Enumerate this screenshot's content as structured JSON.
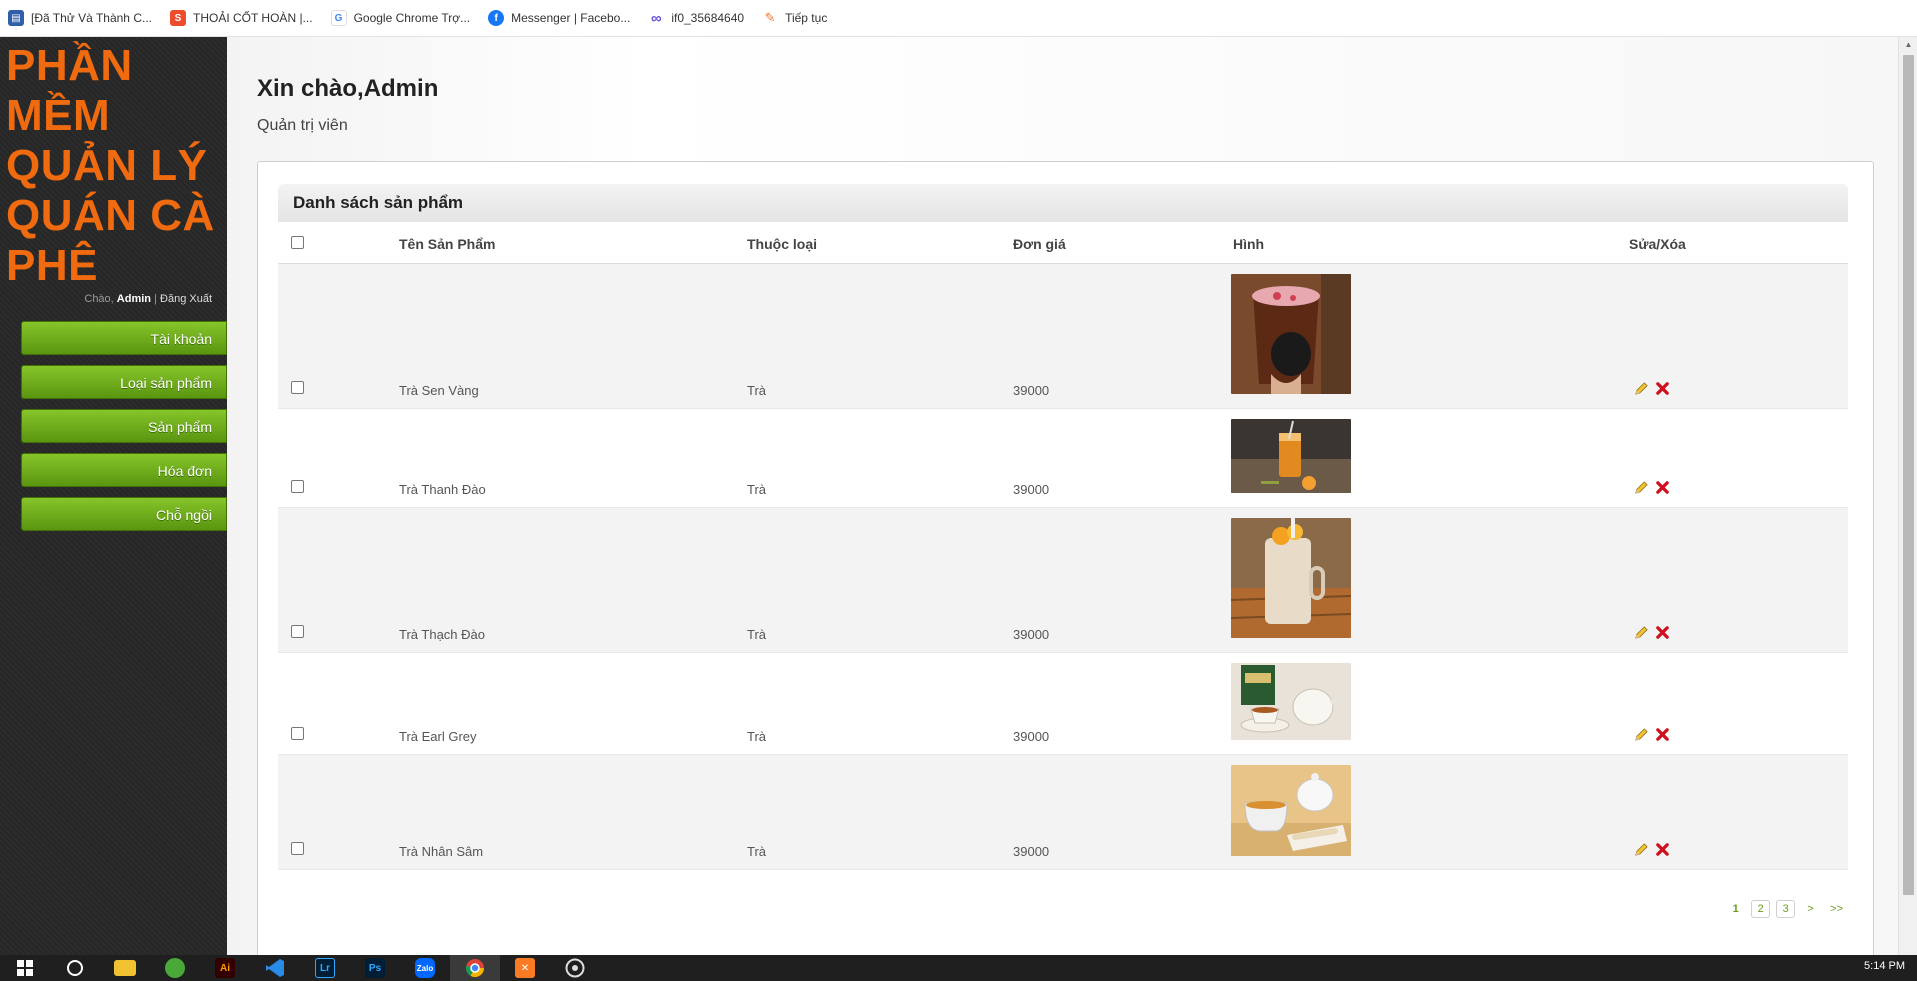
{
  "bookmarks": [
    {
      "label": "[Đã Thử Và Thành C...",
      "icon": "page-icon",
      "color": "#2f5fa8"
    },
    {
      "label": "THOẢI CỐT HOÀN |...",
      "icon": "shop-icon",
      "color": "#ee4d2d"
    },
    {
      "label": "Google Chrome Trợ...",
      "icon": "google-icon",
      "color": "#4285f4"
    },
    {
      "label": "Messenger | Facebo...",
      "icon": "facebook-icon",
      "color": "#1877f2"
    },
    {
      "label": "if0_35684640",
      "icon": "infinity-icon",
      "color": "#6b4fd8"
    },
    {
      "label": "Tiếp tục",
      "icon": "feather-icon",
      "color": "#f0782b"
    }
  ],
  "sidebar": {
    "brand_lines": [
      "PHẦN",
      "MỀM",
      "QUẢN LÝ",
      "QUÁN CÀ",
      "PHÊ"
    ],
    "greeting": "Chào,",
    "user": "Admin",
    "separator": "|",
    "logout": "Đăng Xuất",
    "menu": [
      "Tài khoản",
      "Loại sản phẩm",
      "Sản phẩm",
      "Hóa đơn",
      "Chỗ ngồi"
    ]
  },
  "header": {
    "title": "Xin chào,Admin",
    "subtitle": "Quản trị viên"
  },
  "table": {
    "title": "Danh sách sản phẩm",
    "columns": [
      "Tên Sản Phẩm",
      "Thuộc loại",
      "Đơn giá",
      "Hình",
      "Sửa/Xóa"
    ],
    "rows": [
      {
        "name": "Trà Sen Vàng",
        "category": "Trà",
        "price": "39000"
      },
      {
        "name": "Trà Thanh Đào",
        "category": "Trà",
        "price": "39000"
      },
      {
        "name": "Trà Thạch Đào",
        "category": "Trà",
        "price": "39000"
      },
      {
        "name": "Trà Earl Grey",
        "category": "Trà",
        "price": "39000"
      },
      {
        "name": "Trà Nhân Sâm",
        "category": "Trà",
        "price": "39000"
      }
    ]
  },
  "pagination": [
    "1",
    "2",
    "3",
    ">",
    ">>"
  ],
  "taskbar": {
    "apps": [
      "windows-start-icon",
      "search-icon",
      "file-explorer-icon",
      "browser-icon",
      "illustrator-icon",
      "vscode-icon",
      "lightroom-icon",
      "photoshop-icon",
      "zalo-icon",
      "chrome-icon",
      "xampp-icon",
      "obs-icon"
    ],
    "labels": {
      "illustrator": "Ai",
      "lightroom": "Lr",
      "photoshop": "Ps",
      "zalo": "Zalo"
    },
    "time": "5:14 PM"
  },
  "colors": {
    "brand": "#f06a0f",
    "menu_green": "#6aa81a",
    "page_link": "#6a9d1c",
    "delete": "#d0101e"
  }
}
